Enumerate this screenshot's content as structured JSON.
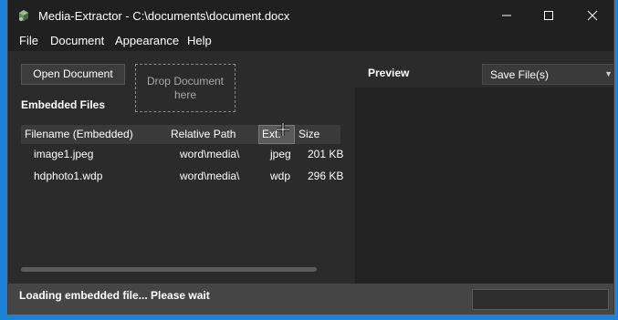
{
  "window": {
    "title": "Media-Extractor - C:\\documents\\document.docx",
    "controls": {
      "minimize": "–",
      "maximize": "☐",
      "close": "✕"
    }
  },
  "menu": {
    "items": [
      {
        "label": "File"
      },
      {
        "label": "Document"
      },
      {
        "label": "Appearance"
      },
      {
        "label": "Help"
      }
    ]
  },
  "toolbar": {
    "open_label": "Open Document",
    "drop_label": "Drop Document here"
  },
  "embedded": {
    "title": "Embedded Files",
    "columns": {
      "filename": "Filename (Embedded)",
      "path": "Relative Path",
      "ext": "Ext.",
      "size": "Size"
    },
    "rows": [
      {
        "filename": "image1.jpeg",
        "path": "word\\media\\",
        "ext": "jpeg",
        "size": "201 KB"
      },
      {
        "filename": "hdphoto1.wdp",
        "path": "word\\media\\",
        "ext": "wdp",
        "size": "296 KB"
      }
    ]
  },
  "preview": {
    "title": "Preview",
    "save_label": "Save File(s)"
  },
  "status": {
    "text": "Loading embedded file... Please wait",
    "progress": 0.0
  },
  "colors": {
    "desktop": "#1b82d8",
    "titlebar": "#202020",
    "status": "#454545",
    "accent": "#06b025"
  },
  "icons": {
    "app": "cube-cluster-icon",
    "cursor": "column-resize-cursor-icon"
  }
}
